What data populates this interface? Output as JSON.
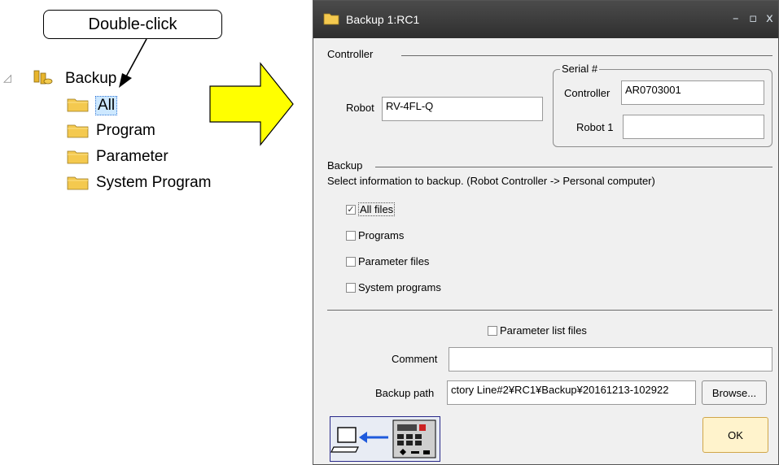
{
  "callout": {
    "text": "Double-click"
  },
  "tree": {
    "root_label": "Backup",
    "items": [
      {
        "label": "All",
        "selected": true
      },
      {
        "label": "Program"
      },
      {
        "label": "Parameter"
      },
      {
        "label": "System Program"
      }
    ]
  },
  "dialog": {
    "title": "Backup 1:RC1",
    "controller_section": "Controller",
    "robot_label": "Robot",
    "robot_value": "RV-4FL-Q",
    "serial_group": "Serial #",
    "serial_controller_label": "Controller",
    "serial_controller_value": "AR0703001",
    "serial_robot1_label": "Robot 1",
    "serial_robot1_value": "",
    "backup_section": "Backup",
    "backup_instruction": "Select information to backup. (Robot Controller -> Personal computer)",
    "options": [
      {
        "label": "All files",
        "checked": true
      },
      {
        "label": "Programs",
        "checked": false
      },
      {
        "label": "Parameter files",
        "checked": false
      },
      {
        "label": "System programs",
        "checked": false
      }
    ],
    "param_list_label": "Parameter list files",
    "comment_label": "Comment",
    "comment_value": "",
    "backup_path_label": "Backup path",
    "backup_path_value": "ctory Line#2¥RC1¥Backup¥20161213-102922",
    "browse_label": "Browse...",
    "ok_label": "OK"
  },
  "colors": {
    "arrow_fill": "#ffff00",
    "titlebar": "#3a3a3a",
    "selection": "#cde8ff",
    "folder": "#f4c94f"
  },
  "icons": [
    "backup-db-icon",
    "folder-icon",
    "transfer-pc-controller-icon"
  ]
}
